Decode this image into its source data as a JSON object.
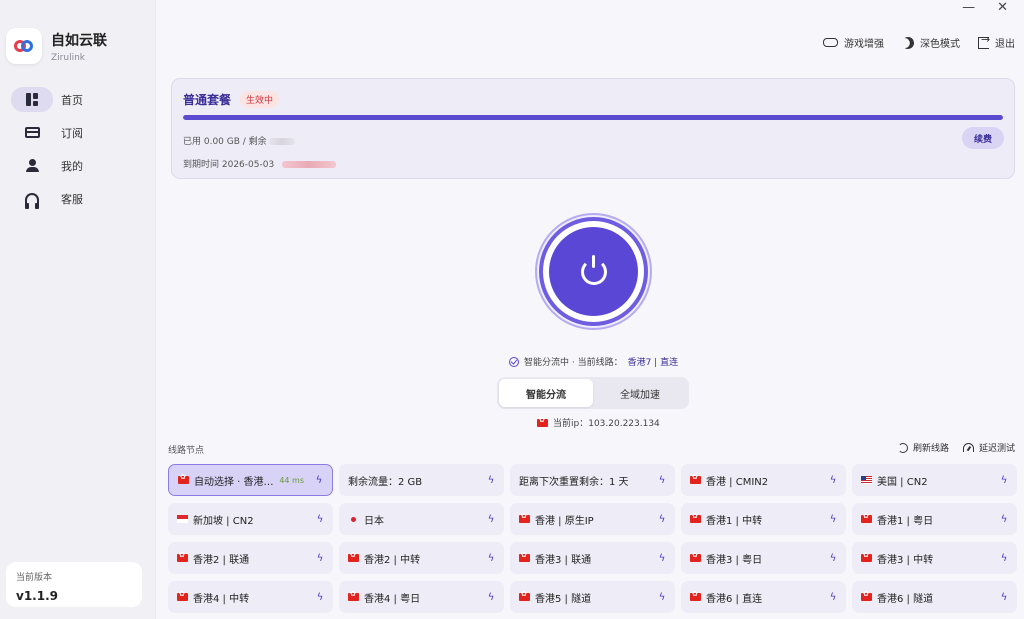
{
  "window": {
    "minimize": "—",
    "close": "✕"
  },
  "brand": {
    "name": "自如云联",
    "sub": "Zirulink"
  },
  "nav": [
    {
      "label": "首页",
      "icon": "dashboard-icon",
      "active": true
    },
    {
      "label": "订阅",
      "icon": "card-icon",
      "active": false
    },
    {
      "label": "我的",
      "icon": "user-icon",
      "active": false
    },
    {
      "label": "客服",
      "icon": "headset-icon",
      "active": false
    }
  ],
  "version": {
    "label": "当前版本",
    "value": "v1.1.9"
  },
  "top_actions": [
    {
      "label": "游戏增强",
      "icon": "gamepad-icon"
    },
    {
      "label": "深色模式",
      "icon": "moon-icon"
    },
    {
      "label": "退出",
      "icon": "logout-icon"
    }
  ],
  "plan": {
    "title": "普通套餐",
    "badge": "生效中",
    "progress": 1.0,
    "used": "已用 0.00 GB / 剩余",
    "expire": "到期时间 2026-05-03",
    "renew": "续费",
    "colors": {
      "accent": "#5b47d6",
      "badge_text": "#d0363f"
    }
  },
  "connection": {
    "status_prefix": "智能分流中 · 当前线路：",
    "status_route": "香港7 | 直连",
    "modes": [
      {
        "label": "智能分流",
        "active": true
      },
      {
        "label": "全域加速",
        "active": false
      }
    ],
    "ip": "当前ip：103.20.223.134"
  },
  "nodes_section": {
    "title": "线路节点",
    "refresh": "刷新线路",
    "latency_test": "延迟测试"
  },
  "nodes": [
    {
      "name": "自动选择 · 香港7...",
      "flag": "hk",
      "latency": "44 ms",
      "selected": true
    },
    {
      "name": "剩余流量：2 GB",
      "flag": ""
    },
    {
      "name": "距离下次重置剩余：1 天",
      "flag": ""
    },
    {
      "name": "香港 | CMIN2",
      "flag": "hk"
    },
    {
      "name": "美国 | CN2",
      "flag": "us"
    },
    {
      "name": "新加坡 | CN2",
      "flag": "sg"
    },
    {
      "name": "日本",
      "flag": "jp"
    },
    {
      "name": "香港 | 原生IP",
      "flag": "hk"
    },
    {
      "name": "香港1 | 中转",
      "flag": "hk"
    },
    {
      "name": "香港1 | 粤日",
      "flag": "hk"
    },
    {
      "name": "香港2 | 联通",
      "flag": "hk"
    },
    {
      "name": "香港2 | 中转",
      "flag": "hk"
    },
    {
      "name": "香港3 | 联通",
      "flag": "hk"
    },
    {
      "name": "香港3 | 粤日",
      "flag": "hk"
    },
    {
      "name": "香港3 | 中转",
      "flag": "hk"
    },
    {
      "name": "香港4 | 中转",
      "flag": "hk"
    },
    {
      "name": "香港4 | 粤日",
      "flag": "hk"
    },
    {
      "name": "香港5 | 隧道",
      "flag": "hk"
    },
    {
      "name": "香港6 | 直连",
      "flag": "hk"
    },
    {
      "name": "香港6 | 隧道",
      "flag": "hk"
    }
  ]
}
